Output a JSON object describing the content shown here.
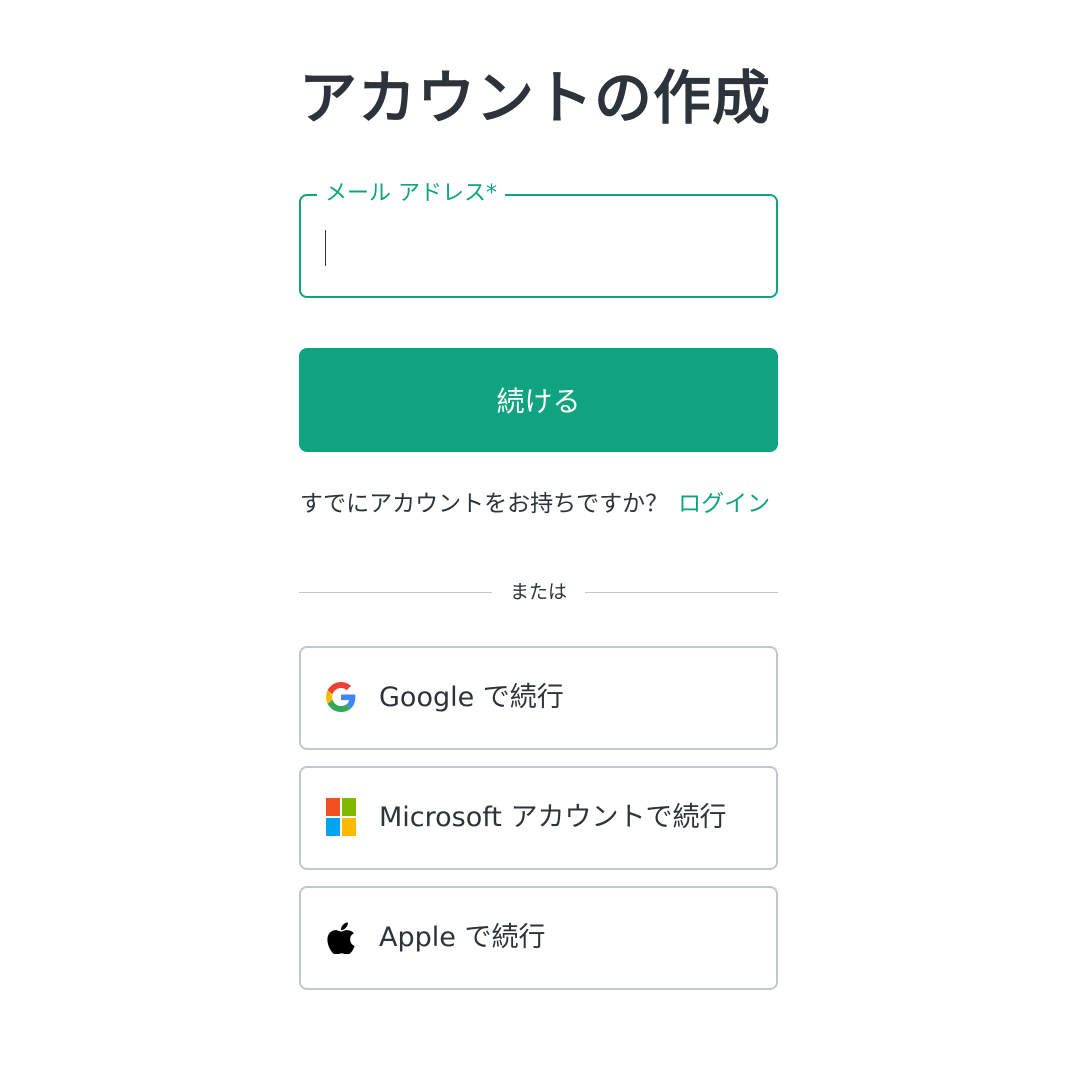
{
  "page": {
    "title": "アカウントの作成"
  },
  "email": {
    "label": "メール アドレス*",
    "value": "",
    "placeholder": ""
  },
  "continue_button": {
    "label": "続ける"
  },
  "login_prompt": {
    "text": "すでにアカウントをお持ちですか？",
    "link_label": "ログイン"
  },
  "divider": {
    "text": "または"
  },
  "social": [
    {
      "icon": "google-icon",
      "label": "Google で続行"
    },
    {
      "icon": "microsoft-icon",
      "label": "Microsoft アカウントで続行"
    },
    {
      "icon": "apple-icon",
      "label": "Apple で続行"
    }
  ],
  "colors": {
    "accent": "#10a37f",
    "text": "#2d333a",
    "border": "#c2c8d0",
    "google_blue": "#4285F4",
    "google_red": "#EA4335",
    "google_yellow": "#FBBC05",
    "google_green": "#34A853",
    "ms_red": "#F25022",
    "ms_green": "#7FBA00",
    "ms_blue": "#00A4EF",
    "ms_yellow": "#FFB900"
  }
}
